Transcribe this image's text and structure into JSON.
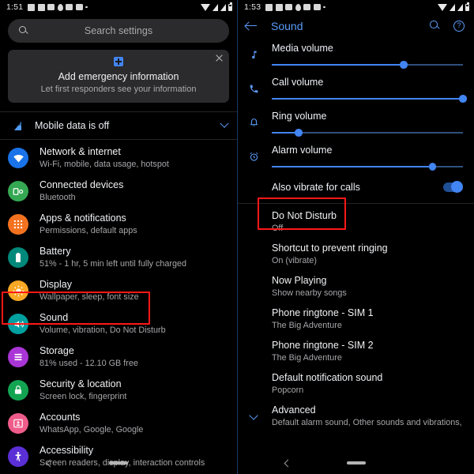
{
  "left": {
    "statusbar": {
      "clock": "1:51",
      "notification_icons": [
        "facebook-icon",
        "music-note-icon",
        "message-icon",
        "location-pin-icon",
        "mail-icon",
        "mail-icon-2",
        "more-dot-icon"
      ],
      "right_icons": [
        "wifi-icon",
        "signal-sim1-icon",
        "signal-sim2-icon",
        "battery-icon"
      ]
    },
    "search": {
      "placeholder": "Search settings"
    },
    "emergency_card": {
      "title": "Add emergency information",
      "subtitle": "Let first responders see your information",
      "icon": "emergency-plus-icon",
      "close_icon": "close-icon"
    },
    "mobile_data": {
      "label": "Mobile data is off",
      "icon": "signal-off-icon",
      "chevron": "chevron-down-icon"
    },
    "items": [
      {
        "title": "Network & internet",
        "subtitle": "Wi-Fi, mobile, data usage, hotspot",
        "icon": "wifi-icon",
        "color": "#1a73e8"
      },
      {
        "title": "Connected devices",
        "subtitle": "Bluetooth",
        "icon": "devices-icon",
        "color": "#34a853"
      },
      {
        "title": "Apps & notifications",
        "subtitle": "Permissions, default apps",
        "icon": "apps-grid-icon",
        "color": "#f4721f"
      },
      {
        "title": "Battery",
        "subtitle": "51% - 1 hr, 5 min left until fully charged",
        "icon": "battery-icon",
        "color": "#00897b"
      },
      {
        "title": "Display",
        "subtitle": "Wallpaper, sleep, font size",
        "icon": "brightness-icon",
        "color": "#f9a825"
      },
      {
        "title": "Sound",
        "subtitle": "Volume, vibration, Do Not Disturb",
        "icon": "volume-icon",
        "color": "#00a0a0",
        "highlighted": true
      },
      {
        "title": "Storage",
        "subtitle": "81% used - 12.10 GB free",
        "icon": "storage-icon",
        "color": "#aa35d6"
      },
      {
        "title": "Security & location",
        "subtitle": "Screen lock, fingerprint",
        "icon": "lock-icon",
        "color": "#13a452"
      },
      {
        "title": "Accounts",
        "subtitle": "WhatsApp, Google, Google",
        "icon": "account-card-icon",
        "color": "#ef5c8a"
      },
      {
        "title": "Accessibility",
        "subtitle": "Screen readers, display, interaction controls",
        "icon": "accessibility-icon",
        "color": "#5b2fd6"
      }
    ],
    "navbar": {
      "back": "back-chevron-icon",
      "home": "home-pill-icon"
    }
  },
  "right": {
    "statusbar": {
      "clock": "1:53",
      "notification_icons": [
        "facebook-icon",
        "music-note-icon",
        "message-icon",
        "location-pin-icon",
        "mail-icon",
        "mail-icon-2",
        "more-dot-icon"
      ],
      "right_icons": [
        "wifi-icon",
        "signal-sim1-icon",
        "signal-sim2-icon",
        "battery-icon"
      ]
    },
    "appbar": {
      "back_icon": "back-arrow-icon",
      "title": "Sound",
      "search_icon": "search-icon",
      "help_icon": "help-icon",
      "help_glyph": "?"
    },
    "sliders": [
      {
        "label": "Media volume",
        "icon": "music-note-icon",
        "value": 69
      },
      {
        "label": "Call volume",
        "icon": "phone-icon",
        "value": 100
      },
      {
        "label": "Ring volume",
        "icon": "bell-icon",
        "value": 14
      },
      {
        "label": "Alarm volume",
        "icon": "alarm-clock-icon",
        "value": 84
      }
    ],
    "vibrate_toggle": {
      "label": "Also vibrate for calls",
      "state": "on"
    },
    "items": [
      {
        "title": "Do Not Disturb",
        "subtitle": "Off",
        "highlighted": true
      },
      {
        "title": "Shortcut to prevent ringing",
        "subtitle": "On (vibrate)"
      },
      {
        "title": "Now Playing",
        "subtitle": "Show nearby songs"
      },
      {
        "title": "Phone ringtone - SIM 1",
        "subtitle": "The Big Adventure"
      },
      {
        "title": "Phone ringtone - SIM 2",
        "subtitle": "The Big Adventure"
      },
      {
        "title": "Default notification sound",
        "subtitle": "Popcorn"
      }
    ],
    "advanced": {
      "title": "Advanced",
      "subtitle": "Default alarm sound, Other sounds and vibrations, Mi Sound En",
      "chevron": "chevron-down-icon"
    },
    "navbar": {
      "back": "back-chevron-icon",
      "home": "home-pill-icon"
    }
  },
  "theme": {
    "accent": "#4285f4",
    "link": "#5b9bf8",
    "highlight": "#ff1717",
    "background": "#000000"
  }
}
